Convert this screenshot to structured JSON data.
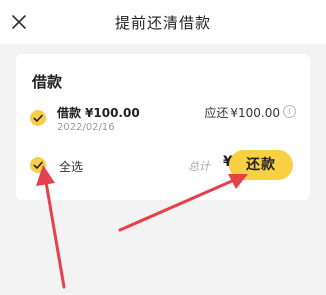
{
  "header": {
    "title": "提前还清借款",
    "close_icon": "close-icon"
  },
  "loan_section": {
    "title": "借款",
    "item": {
      "label": "借款",
      "amount": "¥100.00",
      "date": "2022/02/16",
      "repay_label": "应还",
      "repay_amount": "¥100.00",
      "info_icon_glyph": "i",
      "checked": true
    }
  },
  "footer": {
    "select_all_label": "全选",
    "select_all_checked": true,
    "total_label": "总计",
    "total_amount": "¥100.00",
    "repay_button_label": "还款"
  },
  "colors": {
    "accent": "#f7cf4a",
    "annotation_arrow": "#e8404a",
    "background": "#f3f3f3"
  }
}
